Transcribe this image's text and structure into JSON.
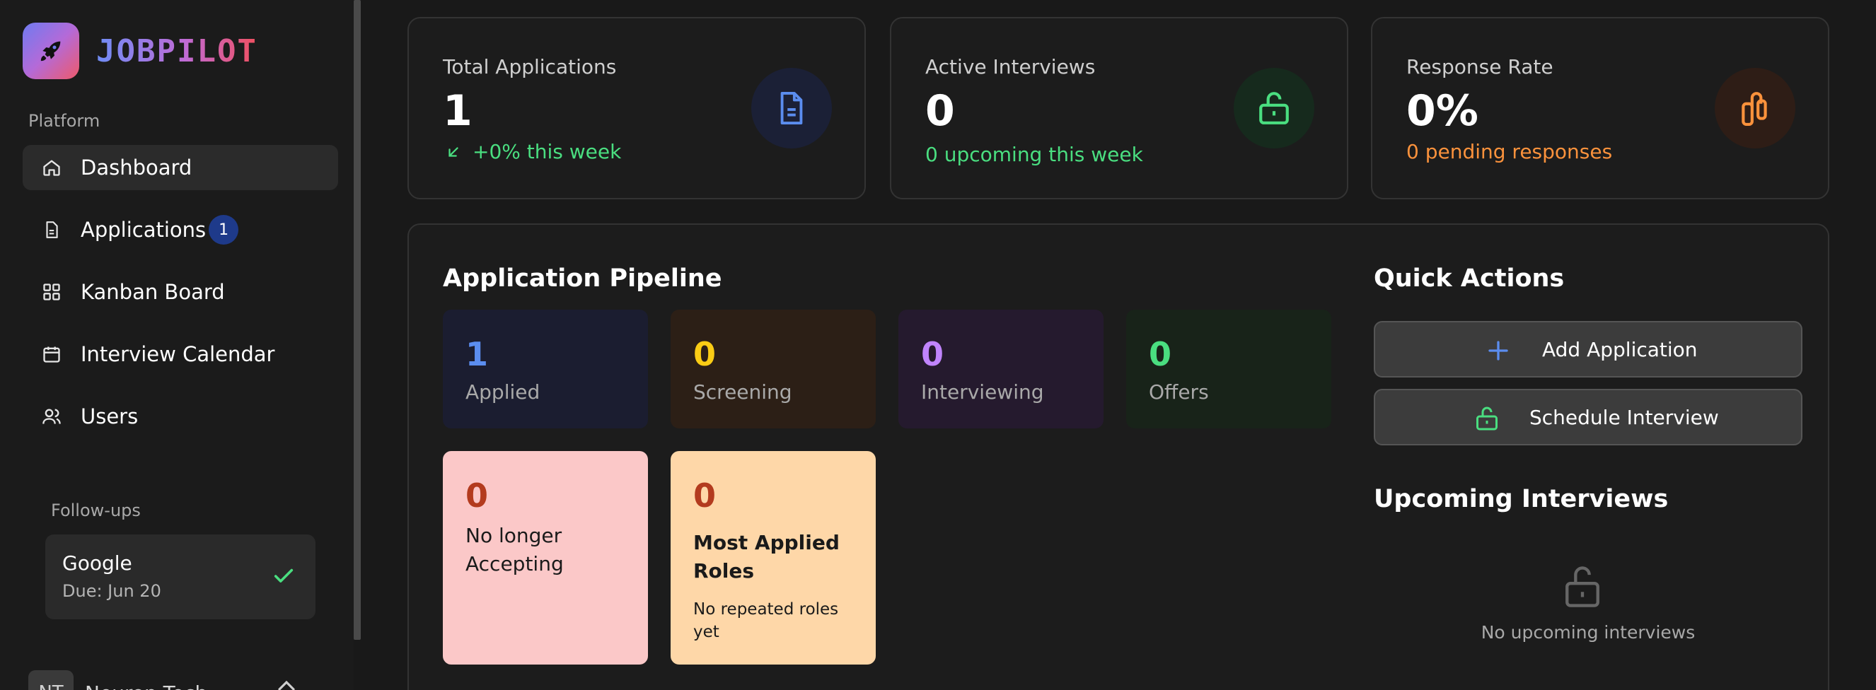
{
  "brand": {
    "name": "JOBPILOT"
  },
  "sidebar": {
    "section_label": "Platform",
    "items": [
      {
        "label": "Dashboard",
        "icon": "home-icon",
        "active": true
      },
      {
        "label": "Applications",
        "icon": "document-icon",
        "badge": "1"
      },
      {
        "label": "Kanban Board",
        "icon": "grid-icon"
      },
      {
        "label": "Interview Calendar",
        "icon": "calendar-icon"
      },
      {
        "label": "Users",
        "icon": "users-icon"
      }
    ],
    "followups_label": "Follow-ups",
    "followup": {
      "company": "Google",
      "due": "Due: Jun 20"
    },
    "user": {
      "initials": "NT",
      "name": "Neuron Tech"
    }
  },
  "stats": {
    "total": {
      "title": "Total Applications",
      "value": "1",
      "sub": "+0% this week"
    },
    "interviews": {
      "title": "Active Interviews",
      "value": "0",
      "sub": "0 upcoming this week"
    },
    "response": {
      "title": "Response Rate",
      "value": "0%",
      "sub": "0 pending responses"
    }
  },
  "pipeline": {
    "title": "Application Pipeline",
    "stages": [
      {
        "count": "1",
        "label": "Applied"
      },
      {
        "count": "0",
        "label": "Screening"
      },
      {
        "count": "0",
        "label": "Interviewing"
      },
      {
        "count": "0",
        "label": "Offers"
      }
    ],
    "no_longer": {
      "count": "0",
      "label": "No longer Accepting"
    },
    "most_applied": {
      "count": "0",
      "title": "Most Applied Roles",
      "sub": "No repeated roles yet"
    }
  },
  "quick_actions": {
    "title": "Quick Actions",
    "add_label": "Add Application",
    "schedule_label": "Schedule Interview"
  },
  "upcoming": {
    "title": "Upcoming Interviews",
    "empty_text": "No upcoming interviews"
  },
  "colors": {
    "blue": "#5b8def",
    "green": "#4ade80",
    "orange": "#fb923c",
    "yellow": "#facc15",
    "purple": "#c084fc",
    "pink_card": "#fecaca",
    "peach_card": "#fed7aa"
  }
}
